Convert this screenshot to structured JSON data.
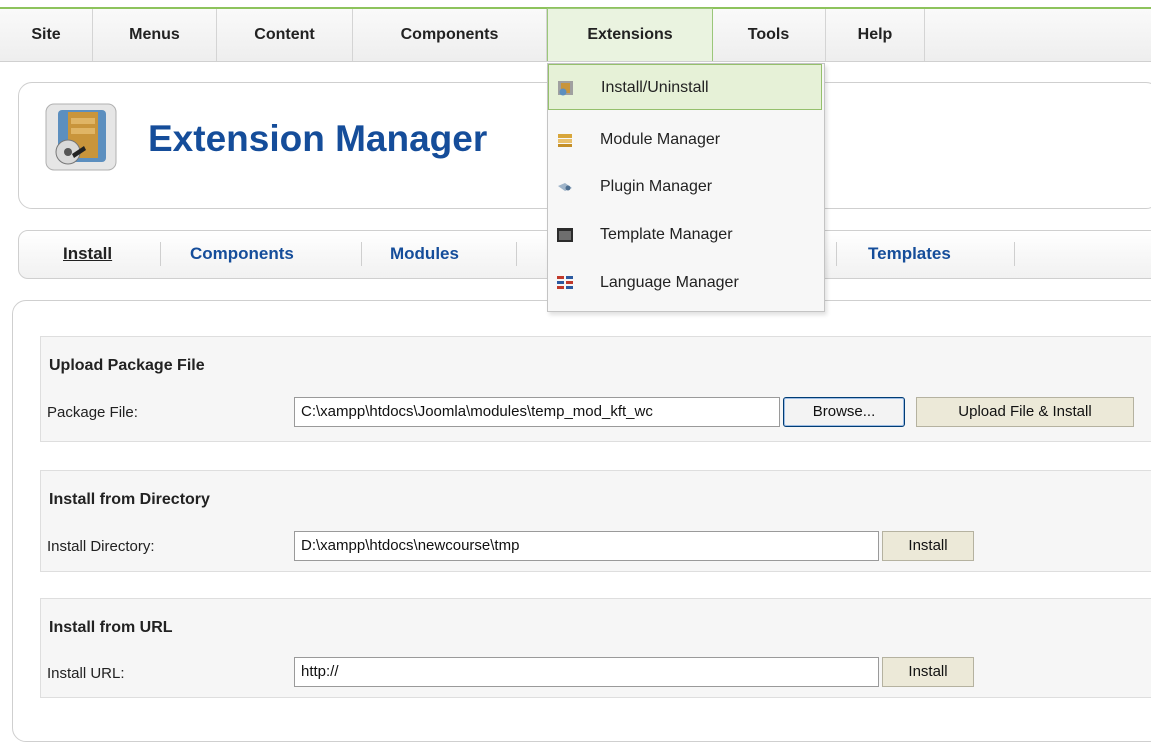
{
  "menubar": {
    "items": [
      {
        "label": "Site"
      },
      {
        "label": "Menus"
      },
      {
        "label": "Content"
      },
      {
        "label": "Components"
      },
      {
        "label": "Extensions"
      },
      {
        "label": "Tools"
      },
      {
        "label": "Help"
      }
    ],
    "active": "Extensions"
  },
  "dropdown": {
    "items": [
      {
        "label": "Install/Uninstall",
        "icon": "install-icon"
      },
      {
        "label": "Module Manager",
        "icon": "module-icon"
      },
      {
        "label": "Plugin Manager",
        "icon": "plugin-icon"
      },
      {
        "label": "Template Manager",
        "icon": "template-icon"
      },
      {
        "label": "Language Manager",
        "icon": "language-icon"
      }
    ]
  },
  "header": {
    "title": "Extension Manager",
    "icon": "extension-manager-icon"
  },
  "tabs": [
    {
      "label": "Install"
    },
    {
      "label": "Components"
    },
    {
      "label": "Modules"
    },
    {
      "label": "Templates"
    }
  ],
  "upload": {
    "title": "Upload Package File",
    "label": "Package File:",
    "value": "C:\\xampp\\htdocs\\Joomla\\modules\\temp_mod_kft_wc",
    "browse_label": "Browse...",
    "submit_label": "Upload File & Install"
  },
  "directory": {
    "title": "Install from Directory",
    "label": "Install Directory:",
    "value": "D:\\xampp\\htdocs\\newcourse\\tmp",
    "button_label": "Install"
  },
  "url": {
    "title": "Install from URL",
    "label": "Install URL:",
    "value": "http://",
    "button_label": "Install"
  },
  "colors": {
    "accent_green": "#8dc35c",
    "title_blue": "#154d9a"
  }
}
